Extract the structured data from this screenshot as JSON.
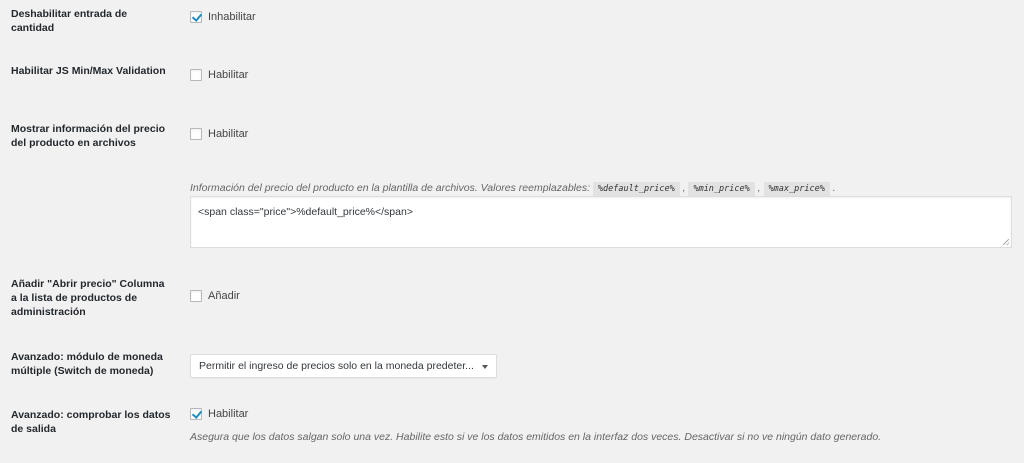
{
  "settings": {
    "disable_qty": {
      "label": "Deshabilitar entrada de cantidad",
      "checkbox_label": "Inhabilitar",
      "checked": true
    },
    "js_minmax": {
      "label": "Habilitar JS Min/Max Validation",
      "checkbox_label": "Habilitar",
      "checked": false
    },
    "archive_price": {
      "label": "Mostrar información del precio del producto en archivos",
      "checkbox_label": "Habilitar",
      "checked": false
    },
    "archive_template": {
      "description_prefix": "Información del precio del producto en la plantilla de archivos. Valores reemplazables:",
      "placeholders": [
        "%default_price%",
        "%min_price%",
        "%max_price%"
      ],
      "sep1": ",",
      "sep2": ",",
      "end": ".",
      "value": "<span class=\"price\">%default_price%</span>"
    },
    "admin_column": {
      "label": "Añadir \"Abrir precio\" Columna a la lista de productos de administración",
      "checkbox_label": "Añadir",
      "checked": false
    },
    "multicurrency": {
      "label": "Avanzado: módulo de moneda múltiple (Switch de moneda)",
      "selected": "Permitir el ingreso de precios solo en la moneda predeter..."
    },
    "check_output": {
      "label": "Avanzado: comprobar los datos de salida",
      "checkbox_label": "Habilitar",
      "checked": true,
      "description": "Asegura que los datos salgan solo una vez. Habilite esto si ve los datos emitidos en la interfaz dos veces. Desactivar si no ve ningún dato generado."
    }
  },
  "colors": {
    "background": "#f1f1f1",
    "check_accent": "#1e8cbe"
  }
}
